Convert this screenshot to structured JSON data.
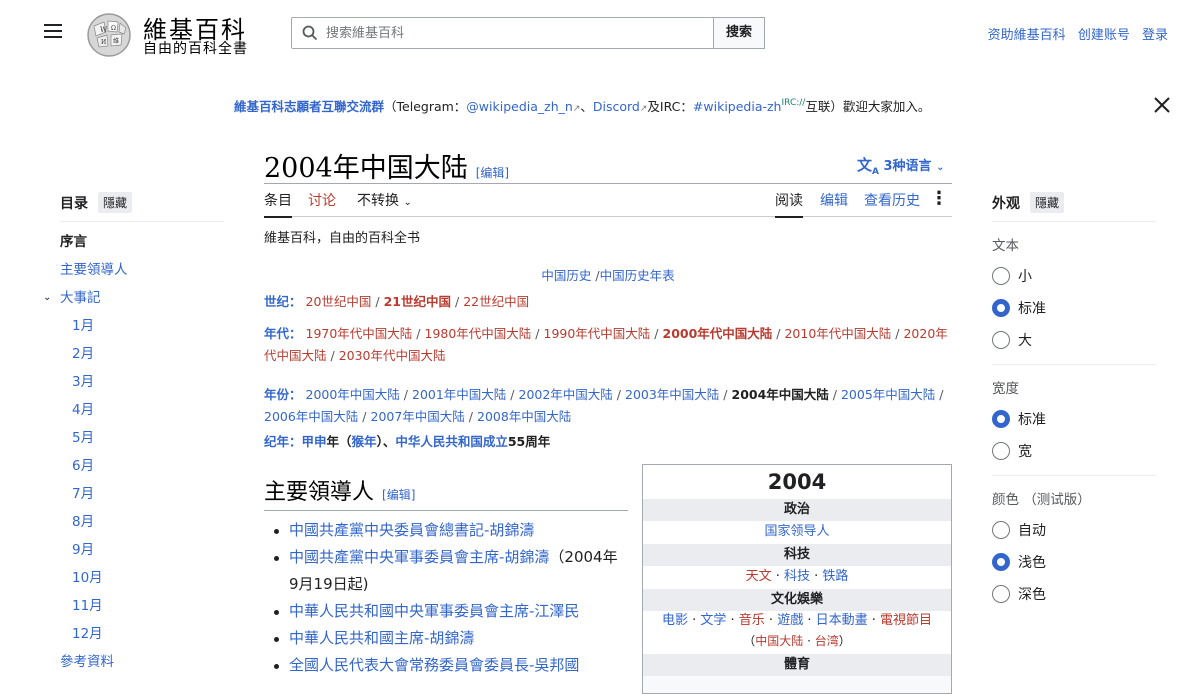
{
  "header": {
    "wordmark": "維基百科",
    "tagline": "自由的百科全書",
    "search_placeholder": "搜索維基百科",
    "search_button": "搜索",
    "links": [
      "资助維基百科",
      "创建账号",
      "登录"
    ]
  },
  "notice": {
    "group": "維基百科志願者互聯交流群",
    "open": "（Telegram：",
    "telegram": "@wikipedia_zh_n",
    "sep1": "、",
    "discord": "Discord",
    "and": "及IRC：",
    "irc": "#wikipedia-zh",
    "irc_sup": "IRC://",
    "close_text": "互联）歡迎大家加入。"
  },
  "page": {
    "title": "2004年中国大陆",
    "edit": "[编辑]",
    "languages": "3种语言",
    "tabs": {
      "article": "条目",
      "talk": "讨论",
      "variant": "不转换",
      "read": "阅读",
      "edit": "编辑",
      "history": "查看历史"
    },
    "tagline": "維基百科，自由的百科全书"
  },
  "toc": {
    "title": "目录",
    "hide": "隱藏",
    "items": [
      "序言",
      "主要領導人",
      "大事記",
      "1月",
      "2月",
      "3月",
      "4月",
      "5月",
      "6月",
      "7月",
      "8月",
      "9月",
      "10月",
      "11月",
      "12月",
      "參考資料"
    ]
  },
  "appearance": {
    "title": "外观",
    "hide": "隱藏",
    "text_label": "文本",
    "text_options": [
      "小",
      "标准",
      "大"
    ],
    "width_label": "宽度",
    "width_options": [
      "标准",
      "宽"
    ],
    "color_label": "颜色 （测试版）",
    "color_options": [
      "自动",
      "浅色",
      "深色"
    ]
  },
  "nav": {
    "history": "中国历史",
    "history_table": "中国历史年表",
    "century_label": "世纪：",
    "centuries": [
      "20世纪中国",
      "21世纪中国",
      "22世纪中国"
    ],
    "decade_label": "年代：",
    "decades": [
      "1970年代中国大陆",
      "1980年代中国大陆",
      "1990年代中国大陆",
      "2000年代中国大陆",
      "2010年代中国大陆",
      "2020年代中国大陆",
      "2030年代中国大陆"
    ],
    "decade_split": [
      "2020年",
      "代中国大陆"
    ],
    "year_label": "年份：",
    "years": [
      "2000年中国大陆",
      "2001年中国大陆",
      "2002年中国大陆",
      "2003年中国大陆",
      "2004年中国大陆",
      "2005年中国大陆",
      "2006年中国大陆",
      "2007年中国大陆",
      "2008年中国大陆"
    ],
    "era_label": "纪年：",
    "era_jiashen": "甲申",
    "era_nian": "年（",
    "era_monkey": "猴年",
    "era_close": "）、",
    "era_prc": "中华人民共和国成立",
    "era_anniv": "55周年"
  },
  "section": {
    "title": "主要領導人",
    "edit": "[编辑]",
    "items": [
      "中國共產黨中央委員會總書記-胡錦濤",
      "中國共產黨中央軍事委員會主席-胡錦濤",
      "中華人民共和國中央軍事委員會主席-江澤民",
      "中華人民共和國主席-胡錦濤",
      "全國人民代表大會常務委員會委員長-吳邦國"
    ],
    "item2_suffix": "（2004年9月19日起)"
  },
  "infobox": {
    "year": "2004",
    "politics": "政治",
    "leaders": "国家领导人",
    "tech": "科技",
    "tech_links": [
      "天文",
      "科技",
      "铁路"
    ],
    "culture": "文化娛樂",
    "culture_links": [
      "电影",
      "文学",
      "音乐",
      "遊戲",
      "日本動畫",
      "電視節目"
    ],
    "tv_open": "（",
    "tv_links": [
      "中国大陆",
      "台湾"
    ],
    "tv_close": "）",
    "sports": "體育"
  }
}
